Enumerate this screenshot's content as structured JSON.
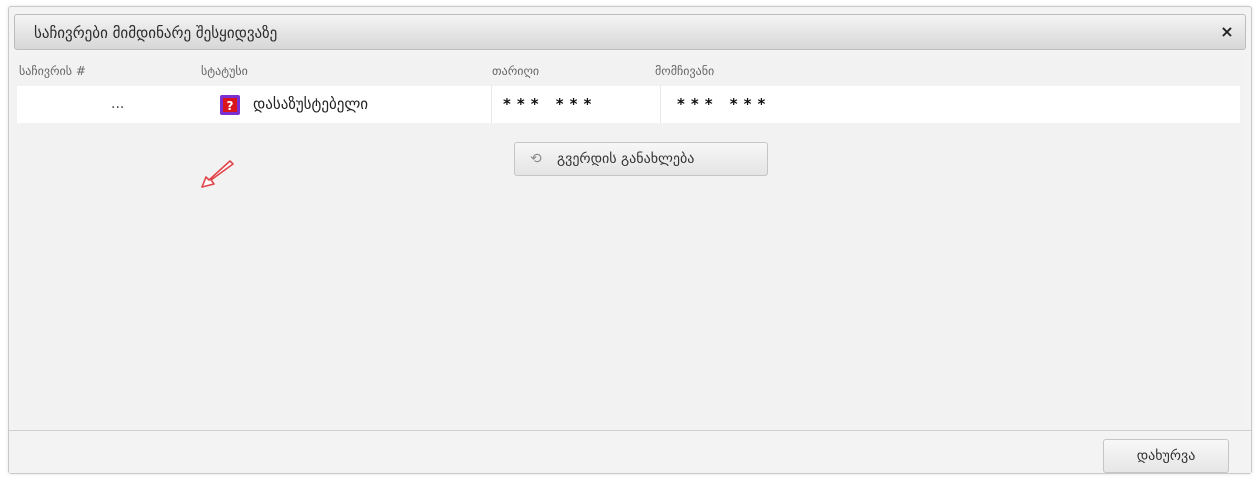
{
  "dialog": {
    "title": "საჩივრები მიმდინარე შესყიდვაზე",
    "close_glyph": "×"
  },
  "table": {
    "headers": [
      "საჩივრის #",
      "სტატუსი",
      "თარიღი",
      "მომჩივანი"
    ],
    "row": {
      "number": "...",
      "status": "დასაზუსტებელი",
      "status_icon": "unknown-status-icon",
      "date": "*** ***",
      "complainant": "*** ***"
    }
  },
  "refresh_button": {
    "icon": "refresh-icon",
    "label": "გვერდის განახლება"
  },
  "footer": {
    "close_label": "დახურვა"
  },
  "colors": {
    "status_icon_bg": "#7a2fd0",
    "status_icon_inner": "#d9141b",
    "arrow_stroke": "#e0454a"
  }
}
